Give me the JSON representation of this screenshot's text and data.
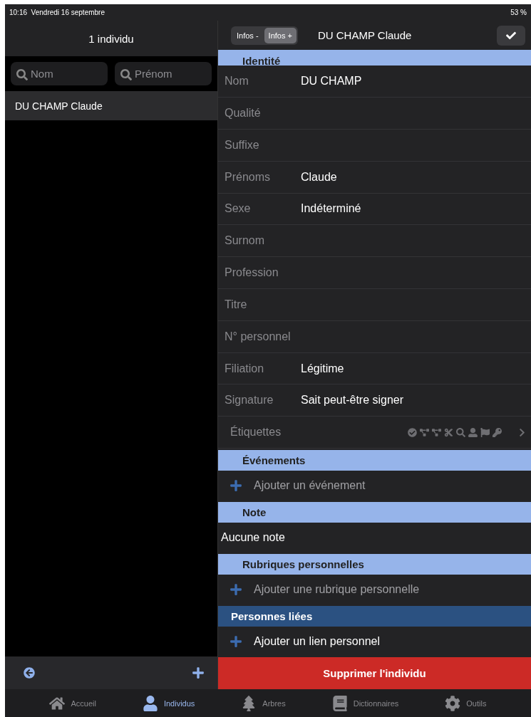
{
  "status_bar": {
    "time": "10:16",
    "date": "Vendredi 16 septembre",
    "battery": "53 %"
  },
  "list_panel": {
    "title": "1 individu",
    "search_fields": [
      {
        "placeholder": "Nom"
      },
      {
        "placeholder": "Prénom"
      }
    ],
    "rows": [
      {
        "name": "DU CHAMP Claude",
        "selected": true
      }
    ]
  },
  "detail": {
    "segments": [
      {
        "label": "Infos -",
        "selected": false
      },
      {
        "label": "Infos +",
        "selected": true
      }
    ],
    "title": "DU CHAMP Claude",
    "identity_header": "Identité",
    "fields": [
      {
        "label": "Nom",
        "value": "DU CHAMP"
      },
      {
        "label": "Qualité"
      },
      {
        "label": "Suffixe"
      },
      {
        "label": "Prénoms",
        "value": "Claude"
      },
      {
        "label": "Sexe",
        "value": "Indéterminé"
      },
      {
        "label": "Surnom"
      },
      {
        "label": "Profession"
      },
      {
        "label": "Titre"
      },
      {
        "label": "N° personnel"
      },
      {
        "label": "Filiation",
        "value": "Légitime"
      },
      {
        "label": "Signature",
        "value": "Sait peut-être signer"
      }
    ],
    "tags_label": "Étiquettes",
    "sections": [
      {
        "title": "Événements",
        "kind": "add",
        "text": "Ajouter un événement",
        "disabled": true
      },
      {
        "title": "Note",
        "kind": "note",
        "text": "Aucune note"
      },
      {
        "title": "Rubriques personnelles",
        "kind": "add",
        "text": "Ajouter une rubrique personnelle",
        "disabled": true
      },
      {
        "title": "Personnes liées",
        "kind": "link",
        "text": "Ajouter un lien personnel",
        "disabled": false
      }
    ],
    "delete_button": "Supprimer l'individu"
  },
  "tab_bar": [
    {
      "label": "Accueil",
      "selected": false
    },
    {
      "label": "Individus",
      "selected": true
    },
    {
      "label": "Arbres",
      "selected": false
    },
    {
      "label": "Dictionnaires",
      "selected": false
    },
    {
      "label": "Outils",
      "selected": false
    }
  ]
}
